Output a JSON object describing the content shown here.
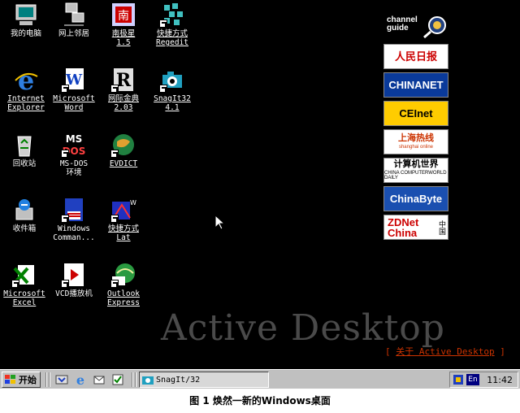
{
  "desktop": {
    "icons": [
      {
        "label": "我的电脑",
        "icon": "my-computer-icon"
      },
      {
        "label": "网上邻居",
        "icon": "network-neighborhood-icon"
      },
      {
        "label": "南极星\n1.5",
        "icon": "njstar-icon"
      },
      {
        "label": "快捷方式\nRegedit",
        "icon": "regedit-shortcut-icon"
      },
      {
        "label": "Internet\nExplorer",
        "icon": "internet-explorer-icon"
      },
      {
        "label": "Microsoft\nWord",
        "icon": "word-icon"
      },
      {
        "label": "网际金典\n2.03",
        "icon": "dictionary-icon"
      },
      {
        "label": "SnagIt32\n4.1",
        "icon": "snagit-icon"
      },
      {
        "label": "回收站",
        "icon": "recycle-bin-icon"
      },
      {
        "label": "MS-DOS\n环境",
        "icon": "ms-dos-icon"
      },
      {
        "label": "EVDICT",
        "icon": "evdict-icon"
      },
      {
        "label": "收件箱",
        "icon": "inbox-icon"
      },
      {
        "label": "Windows\nComman...",
        "icon": "windows-commander-icon"
      },
      {
        "label": "快捷方式\nLat",
        "icon": "lat-shortcut-icon"
      },
      {
        "label": "Microsoft\nExcel",
        "icon": "excel-icon"
      },
      {
        "label": "VCD播放机",
        "icon": "vcd-player-icon"
      },
      {
        "label": "Outlook\nExpress",
        "icon": "outlook-express-icon"
      }
    ],
    "active_desktop_title": "Active Desktop",
    "active_desktop_link": {
      "open": "[ ",
      "text": "关于 Active Desktop",
      "close": " ]"
    }
  },
  "channel_bar": {
    "guide_label": "channel\nguide",
    "channels": [
      {
        "text": "人民日报",
        "bg": "#ffffff",
        "fg": "#cc0000"
      },
      {
        "text": "CHINANET",
        "bg": "#0a3a9a",
        "fg": "#ffffff"
      },
      {
        "text": "CEInet",
        "bg": "#ffcc00",
        "fg": "#000000"
      },
      {
        "text": "上海热线",
        "bg": "#ffffff",
        "fg": "#cc3300",
        "sub": "shanghai online"
      },
      {
        "text": "计算机世界",
        "bg": "#ffffff",
        "fg": "#000000",
        "sub": "CHINA COMPUTERWORLD DAILY"
      },
      {
        "text": "ChinaByte",
        "bg": "#1a4fb0",
        "fg": "#ffffff"
      },
      {
        "text": "ZDNet China",
        "bg": "#ffffff",
        "fg": "#000000",
        "accent": "#cc0000",
        "side": "中国"
      }
    ]
  },
  "taskbar": {
    "start_label": "开始",
    "quick_launch": [
      "show-desktop-icon",
      "ie-quick-icon",
      "outlook-quick-icon",
      "channels-quick-icon"
    ],
    "task_label": "SnagIt/32",
    "ime_label": "En",
    "clock": "11:42"
  },
  "caption": "图 1  焕然一新的Windows桌面"
}
